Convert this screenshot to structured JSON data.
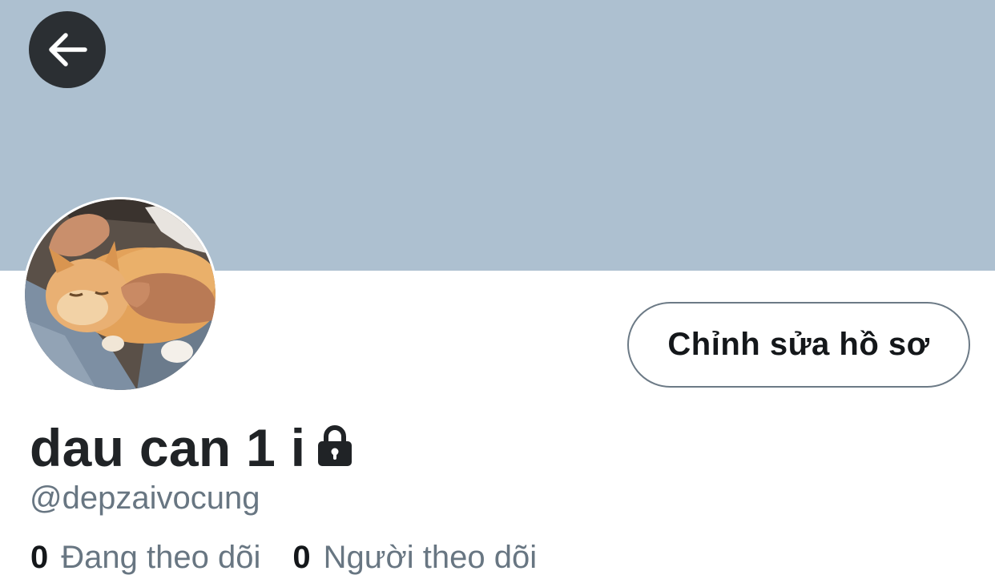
{
  "header": {
    "back_icon": "arrow-left-icon",
    "banner_color": "#adc0d0"
  },
  "profile": {
    "avatar_description_icon": "avatar-photo",
    "edit_button_label": "Chỉnh sửa hồ sơ",
    "display_name": "dau can 1 i",
    "protected_icon": "lock-icon",
    "handle": "@depzaivocung"
  },
  "stats": {
    "following_count": "0",
    "following_label": "Đang theo dõi",
    "followers_count": "0",
    "followers_label": "Người theo dõi"
  }
}
